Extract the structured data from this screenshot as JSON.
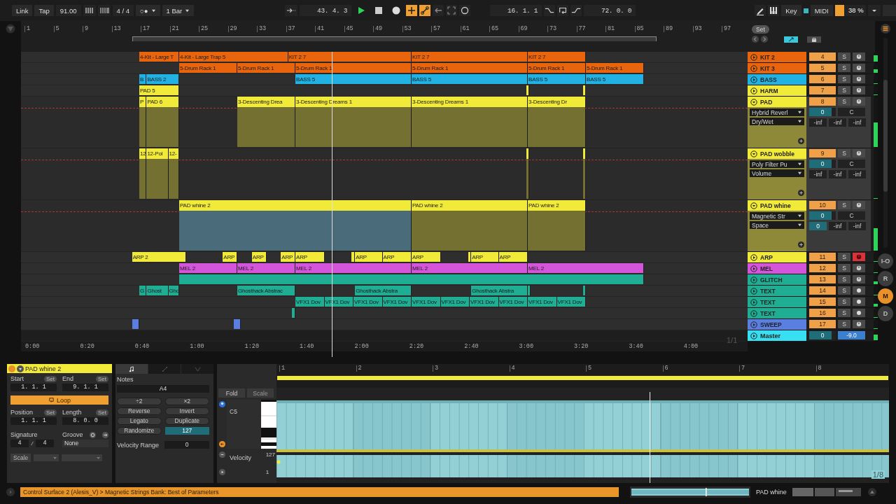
{
  "transport": {
    "link": "Link",
    "tap": "Tap",
    "tempo": "91.00",
    "signature": "4 / 4",
    "follow": "○●",
    "quantize": "1 Bar",
    "position": "43. 4. 3",
    "playing": true,
    "overdub": true,
    "automation_arm": true,
    "loop_start": "16. 1. 1",
    "loop_length": "72. 0. 0",
    "key": "Key",
    "midi": "MIDI",
    "cpu": {
      "reading": "38 %",
      "level": 0.3
    }
  },
  "ruler": {
    "bars": [
      "1",
      "5",
      "9",
      "13",
      "17",
      "21",
      "25",
      "29",
      "33",
      "37",
      "41",
      "45",
      "49",
      "53",
      "57",
      "61",
      "65",
      "69",
      "73",
      "77",
      "81",
      "85",
      "89",
      "93",
      "97"
    ]
  },
  "set_button": "Set",
  "tracks": [
    {
      "name": "KIT 2",
      "color": "#e8650e",
      "number": "4",
      "solo": "S",
      "kind": "clock",
      "armed": false,
      "expanded": false,
      "level": 0.7,
      "clips": [
        {
          "name": "4-Kit - Large T",
          "selected": false
        },
        {
          "name": "4-Kit - Large Trap 5",
          "selected": false
        },
        {
          "name": "KIT 2 7",
          "selected": false
        },
        {
          "name": "KIT 2 7",
          "selected": false
        },
        {
          "name": "KIT 2 7",
          "selected": false
        }
      ]
    },
    {
      "name": "KIT 3",
      "color": "#e8650e",
      "number": "5",
      "solo": "S",
      "kind": "clock",
      "armed": false,
      "expanded": false,
      "level": 0.4,
      "clips": [
        {
          "name": "5-Drum Rack 1",
          "selected": false
        },
        {
          "name": "5-Drum Rack 1",
          "selected": false
        },
        {
          "name": "5-Drum Rack 1",
          "selected": false
        },
        {
          "name": "5-Drum Rack 1",
          "selected": false
        },
        {
          "name": "5-Drum Rack 1",
          "selected": false
        },
        {
          "name": "5-Drum Rack 1",
          "selected": false
        }
      ]
    },
    {
      "name": "BASS",
      "color": "#21b1e3",
      "number": "6",
      "solo": "S",
      "kind": "clock",
      "armed": false,
      "expanded": false,
      "level": 0,
      "clips": [
        {
          "name": "B",
          "selected": false
        },
        {
          "name": "BASS 2",
          "selected": false
        },
        {
          "name": "BASS 5",
          "selected": false
        },
        {
          "name": "BASS 5",
          "selected": false
        },
        {
          "name": "BASS 5",
          "selected": false
        },
        {
          "name": "BASS 5",
          "selected": false
        }
      ]
    },
    {
      "name": "HARM",
      "color": "#f2ea38",
      "number": "7",
      "solo": "S",
      "kind": "clock",
      "armed": false,
      "expanded": false,
      "level": 0,
      "clips": [
        {
          "name": "PAD 5",
          "selected": false
        },
        {
          "selected": false
        },
        {
          "selected": false
        }
      ]
    },
    {
      "name": "PAD",
      "color": "#f2ea38",
      "number": "8",
      "solo": "S",
      "kind": "clock",
      "armed": false,
      "expanded": true,
      "level": 0.5,
      "device": "Hybrid Reverl",
      "parameter": "Dry/Wet",
      "volume": {
        "value": "0",
        "level": 0.85
      },
      "pan": "C",
      "sends": [
        {
          "value": "-inf",
          "active": false
        },
        {
          "value": "-inf",
          "active": false
        },
        {
          "value": "-inf",
          "active": false
        }
      ],
      "clips": [
        {
          "name": "P",
          "selected": false
        },
        {
          "name": "PAD 6",
          "selected": false
        },
        {
          "name": "3-Descenting Drea",
          "selected": false
        },
        {
          "name": "3-Descenting Dreams 1",
          "selected": false
        },
        {
          "name": "3-Descenting Dreams 1",
          "selected": false
        },
        {
          "name": "3-Descenting Dr",
          "selected": false
        }
      ]
    },
    {
      "name": "PAD wobble",
      "color": "#f2ea38",
      "number": "9",
      "solo": "S",
      "kind": "clock",
      "armed": false,
      "expanded": true,
      "level": 0,
      "device": "Poly Filter Pu",
      "parameter": "Volume",
      "volume": {
        "value": "0",
        "level": 0.85
      },
      "pan": "C",
      "sends": [
        {
          "value": "-inf",
          "active": false
        },
        {
          "value": "-inf",
          "active": false
        },
        {
          "value": "-inf",
          "active": false
        }
      ],
      "clips": [
        {
          "name": "12",
          "selected": false
        },
        {
          "name": "12-Pol",
          "selected": false
        },
        {
          "name": "12-",
          "selected": false
        },
        {
          "selected": false
        },
        {
          "selected": false
        }
      ]
    },
    {
      "name": "PAD whine",
      "color": "#f2ea38",
      "number": "10",
      "solo": "S",
      "kind": "clock",
      "armed": false,
      "expanded": true,
      "level": 0.45,
      "device": "Magnetic Str",
      "parameter": "Space",
      "volume": {
        "value": "0",
        "level": 0.85
      },
      "pan": "C",
      "sends": [
        {
          "value": "0",
          "active": true
        },
        {
          "value": "-inf",
          "active": false
        },
        {
          "value": "-inf",
          "active": false
        }
      ],
      "clips": [
        {
          "name": "PAD whine 2",
          "selected": true
        },
        {
          "name": "PAD whine 2",
          "selected": false
        },
        {
          "name": "PAD whine 2",
          "selected": false
        }
      ]
    },
    {
      "name": "ARP",
      "color": "#f2ea38",
      "number": "11",
      "solo": "S",
      "kind": "clock",
      "armed": true,
      "expanded": false,
      "level": 0,
      "clips": [
        {
          "name": "ARP 2",
          "selected": false
        },
        {
          "name": "ARP",
          "selected": false
        },
        {
          "name": "ARP",
          "selected": false
        },
        {
          "name": "ARP",
          "selected": false
        },
        {
          "name": "ARP",
          "selected": false
        },
        {
          "selected": false
        },
        {
          "name": "ARP",
          "selected": false
        },
        {
          "name": "ARP",
          "selected": false
        },
        {
          "name": "ARP",
          "selected": false
        },
        {
          "selected": false
        },
        {
          "name": "ARP",
          "selected": false
        },
        {
          "name": "ARP",
          "selected": false
        }
      ]
    },
    {
      "name": "MEL",
      "color": "#d455da",
      "number": "12",
      "solo": "S",
      "kind": "clock",
      "armed": false,
      "expanded": false,
      "level": 0,
      "clips": [
        {
          "name": "MEL 2",
          "selected": false
        },
        {
          "name": "MEL 2",
          "selected": false
        },
        {
          "name": "MEL 2",
          "selected": false
        },
        {
          "name": "MEL 2",
          "selected": false
        },
        {
          "name": "MEL 2",
          "selected": false
        }
      ]
    },
    {
      "name": "GLITCH",
      "color": "#1fae93",
      "number": "13",
      "solo": "S",
      "kind": "clock",
      "armed": false,
      "expanded": false,
      "level": 0.3,
      "clips": [
        {
          "selected": false
        }
      ]
    },
    {
      "name": "TEXT",
      "color": "#1fae93",
      "number": "14",
      "solo": "S",
      "kind": "dot",
      "armed": false,
      "expanded": false,
      "level": 0,
      "clips": [
        {
          "name": "G",
          "selected": false
        },
        {
          "name": "Ghost",
          "selected": false
        },
        {
          "name": "Gho",
          "selected": false
        },
        {
          "name": "Ghosthack Abstrac",
          "selected": false
        },
        {
          "name": "Ghosthack Abstra",
          "selected": false
        },
        {
          "name": "Ghosthack Abstra",
          "selected": false
        },
        {
          "selected": false
        },
        {
          "selected": false
        }
      ]
    },
    {
      "name": "TEXT",
      "color": "#1fae93",
      "number": "15",
      "solo": "S",
      "kind": "dot",
      "armed": false,
      "expanded": false,
      "level": 0.3,
      "clips": [
        {
          "name": "VFX1 Dov",
          "selected": false
        },
        {
          "name": "VFX1 Dov",
          "selected": false
        },
        {
          "name": "VFX1 Dov",
          "selected": false
        },
        {
          "name": "VFX1 Dov",
          "selected": false
        },
        {
          "name": "VFX1 Dov",
          "selected": false
        },
        {
          "name": "VFX1 Dov",
          "selected": false
        },
        {
          "name": "VFX1 Dov",
          "selected": false
        },
        {
          "name": "VFX1 Dov",
          "selected": false
        },
        {
          "name": "VFX1 Dov",
          "selected": false
        },
        {
          "name": "VFX1 Dov",
          "selected": false
        }
      ]
    },
    {
      "name": "TEXT",
      "color": "#1fae93",
      "number": "16",
      "solo": "S",
      "kind": "dot",
      "armed": false,
      "expanded": false,
      "level": 0,
      "clips": [
        {
          "selected": false
        }
      ]
    },
    {
      "name": "SWEEP",
      "color": "#5a7fe0",
      "number": "17",
      "solo": "S",
      "kind": "clock",
      "armed": false,
      "expanded": false,
      "level": 0,
      "clips": [
        {
          "selected": false
        },
        {
          "selected": false
        }
      ]
    }
  ],
  "master": {
    "name": "Master",
    "color": "#38dff0",
    "volume": {
      "value": "0",
      "level": 0.85
    },
    "pan": "-9.0",
    "level": 0.6
  },
  "time_ruler": {
    "times": [
      "0:00",
      "0:20",
      "0:40",
      "1:00",
      "1:20",
      "1:40",
      "2:00",
      "2:20",
      "2:40",
      "3:00",
      "3:20",
      "3:40",
      "4:00"
    ],
    "page": "1/1"
  },
  "side_buttons": [
    {
      "label": "I-O",
      "selected": false
    },
    {
      "label": "R",
      "selected": false
    },
    {
      "label": "M",
      "selected": true
    },
    {
      "label": "D",
      "selected": false
    }
  ],
  "clip_view": {
    "title": "PAD whine 2",
    "color": "#f2ea38",
    "fields": [
      {
        "label": "Start",
        "set": "Set",
        "value": "1. 1. 1"
      },
      {
        "label": "End",
        "set": "Set",
        "value": "9. 1. 1"
      },
      {
        "label": "Position",
        "set": "Set",
        "value": "1. 1. 1"
      },
      {
        "label": "Length",
        "set": "Set",
        "value": "8. 0. 0"
      }
    ],
    "loop": {
      "label": "Loop",
      "on": true
    },
    "signature_label": "Signature",
    "groove_label": "Groove",
    "numerator": "4",
    "denominator": "4",
    "groove": "None",
    "scale": "Scale"
  },
  "notes_view": {
    "tabs": [
      {
        "kind": "notes",
        "selected": true
      },
      {
        "kind": "envelope",
        "selected": false
      },
      {
        "kind": "curve",
        "selected": false
      }
    ],
    "title": "Notes",
    "note": "A4",
    "buttons": [
      "÷2",
      "×2",
      "Reverse",
      "Invert",
      "Legato",
      "Duplicate"
    ],
    "randomize": "Randomize",
    "amount": "127",
    "velocity_range_label": "Velocity Range",
    "velocity_range": "0"
  },
  "piano_roll": {
    "fold": "Fold",
    "scale": "Scale",
    "key": "C5",
    "bars": [
      "1",
      "2",
      "3",
      "4",
      "5",
      "6",
      "7",
      "8"
    ],
    "velocity_label": "Velocity",
    "velocity_max": "127",
    "velocity_min": "1",
    "grid": "1/8"
  },
  "status_bar": {
    "message": "Control Surface 2 (Alesis_V) > Magnetic Strings Bank: Best of Parameters",
    "track": "PAD whine"
  }
}
